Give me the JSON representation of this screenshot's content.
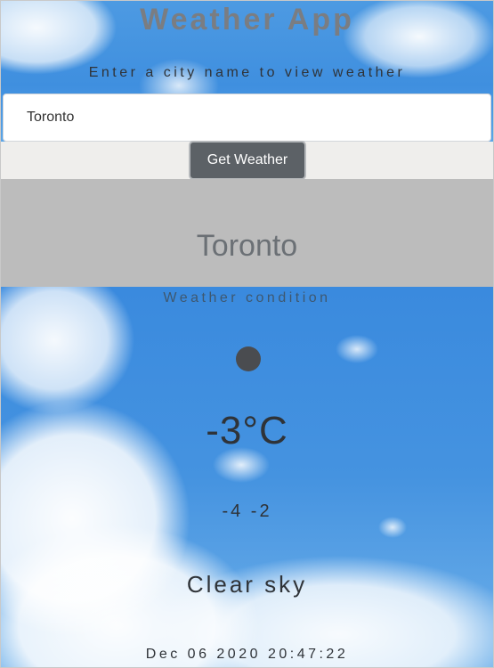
{
  "app": {
    "title": "Weather App",
    "subtitle": "Enter a city name to view weather"
  },
  "search": {
    "value": "Toronto",
    "button_label": "Get Weather"
  },
  "weather": {
    "city": "Toronto",
    "condition_label": "Weather condition",
    "icon": "weather-dot-icon",
    "temperature": "-3°C",
    "min_max": "-4 -2",
    "description": "Clear sky",
    "datetime": "Dec 06 2020 20:47:22"
  },
  "colors": {
    "button": "#5c6166",
    "city_band": "#bcbcbc",
    "sky": "#4593e0"
  }
}
